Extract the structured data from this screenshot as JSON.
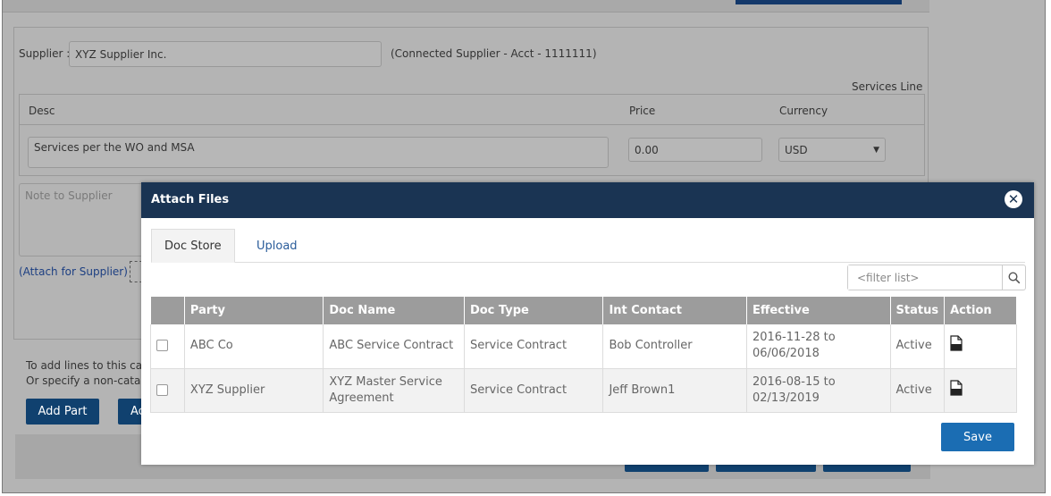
{
  "background": {
    "supplier_label": "Supplier :",
    "supplier_value": "XYZ Supplier Inc.",
    "connected_note": "(Connected Supplier - Acct - 1111111)",
    "services_line": "Services Line",
    "lines": {
      "headers": {
        "desc": "Desc",
        "price": "Price",
        "currency": "Currency"
      },
      "desc_value": "Services per the WO and MSA",
      "price_value": "0.00",
      "currency_value": "USD"
    },
    "note_placeholder": "Note to Supplier",
    "attach_link": "(Attach for Supplier)",
    "cart_text_1": "To add lines to this cart",
    "cart_text_2": "Or specify a non-catalo",
    "add_part_button": "Add Part",
    "second_button": "Ac"
  },
  "modal": {
    "title": "Attach Files",
    "close_icon": "close-icon",
    "tabs": [
      {
        "label": "Doc Store",
        "active": true
      },
      {
        "label": "Upload",
        "active": false
      }
    ],
    "filter": {
      "placeholder": "<filter list>"
    },
    "table": {
      "columns": [
        "Party",
        "Doc Name",
        "Doc Type",
        "Int Contact",
        "Effective",
        "Status",
        "Action"
      ],
      "rows": [
        {
          "party": "ABC Co",
          "doc_name": "ABC Service Contract",
          "doc_type": "Service Contract",
          "contact": "Bob Controller",
          "effective": "2016-11-28 to 06/06/2018",
          "status": "Active",
          "action_icon": "pdf-icon"
        },
        {
          "party": "XYZ Supplier",
          "doc_name": "XYZ Master Service Agreement",
          "doc_type": "Service Contract",
          "contact": "Jeff Brown1",
          "effective": "2016-08-15 to 02/13/2019",
          "status": "Active",
          "action_icon": "pdf-icon"
        }
      ]
    },
    "save_button": "Save"
  },
  "colors": {
    "modal_header": "#1a3453",
    "save_button": "#1b6db3",
    "table_header": "#9c9c9c",
    "bg_button": "#10416f"
  }
}
